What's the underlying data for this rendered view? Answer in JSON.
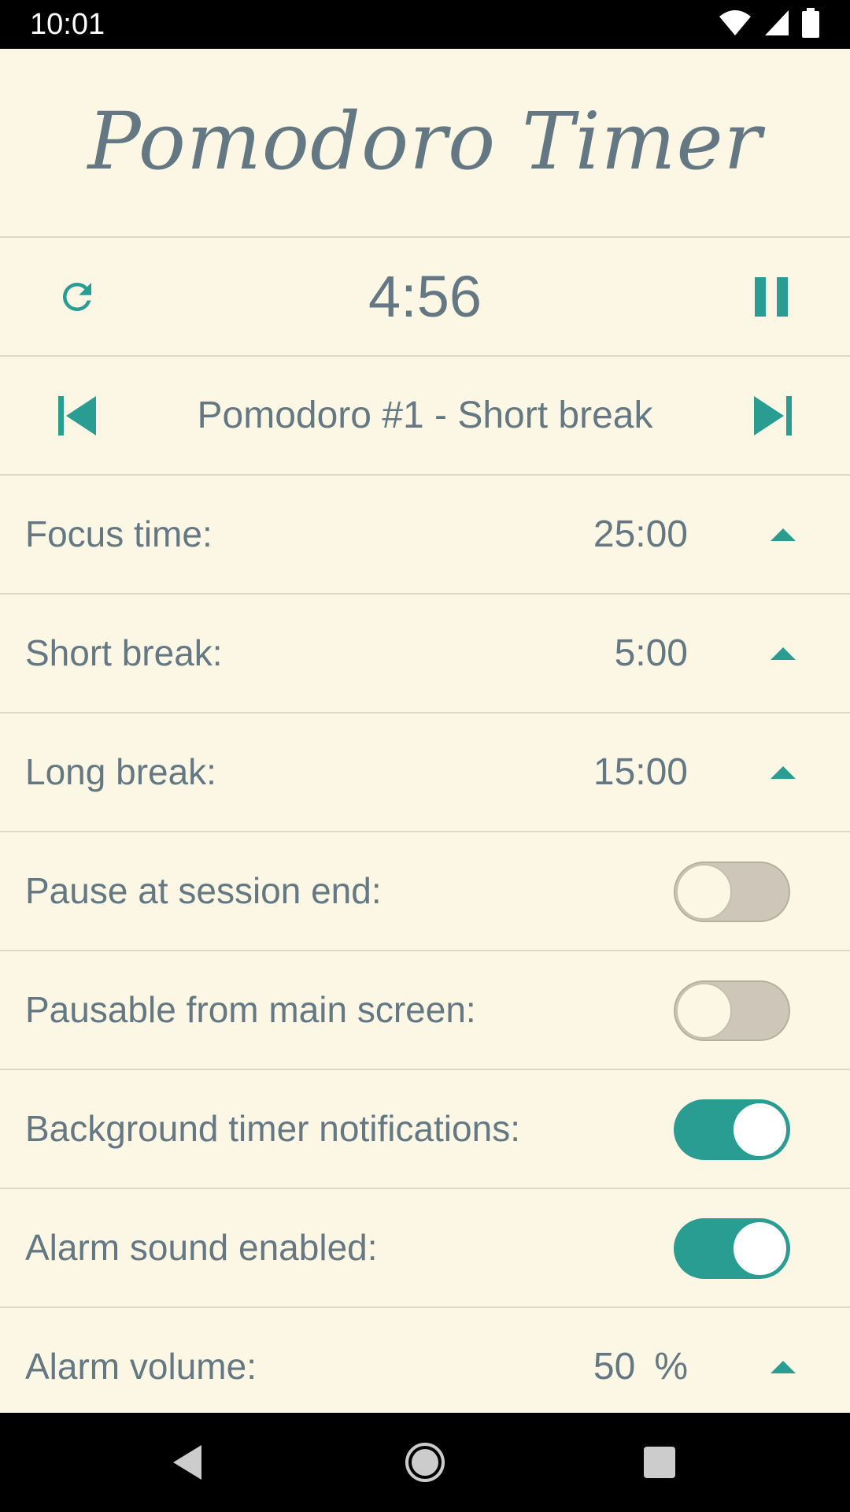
{
  "status_bar": {
    "time": "10:01",
    "icons": [
      "wifi-icon",
      "cell-signal-icon",
      "battery-icon"
    ]
  },
  "app": {
    "title": "Pomodoro Timer"
  },
  "timer": {
    "display": "4:56",
    "reset_icon": "refresh-icon",
    "pause_icon": "pause-icon"
  },
  "session": {
    "label": "Pomodoro #1 - Short break",
    "prev_icon": "skip-previous-icon",
    "next_icon": "skip-next-icon"
  },
  "settings": {
    "focus_time": {
      "label": "Focus time:",
      "value": "25:00"
    },
    "short_break": {
      "label": "Short break:",
      "value": "5:00"
    },
    "long_break": {
      "label": "Long break:",
      "value": "15:00"
    },
    "pause_at_session_end": {
      "label": "Pause at session end:",
      "enabled": false
    },
    "pausable_from_main": {
      "label": "Pausable from main screen:",
      "enabled": false
    },
    "background_notifications": {
      "label": "Background timer notifications:",
      "enabled": true
    },
    "alarm_sound": {
      "label": "Alarm sound enabled:",
      "enabled": true
    },
    "alarm_volume": {
      "label": "Alarm volume:",
      "value": "50",
      "unit": "%"
    }
  },
  "colors": {
    "background": "#fcf6e5",
    "text": "#637883",
    "accent": "#2a9d93",
    "divider": "#ddd8c9",
    "toggle_off": "#cec6b8"
  },
  "nav_bar": {
    "icons": [
      "back-icon",
      "home-icon",
      "recents-icon"
    ]
  }
}
